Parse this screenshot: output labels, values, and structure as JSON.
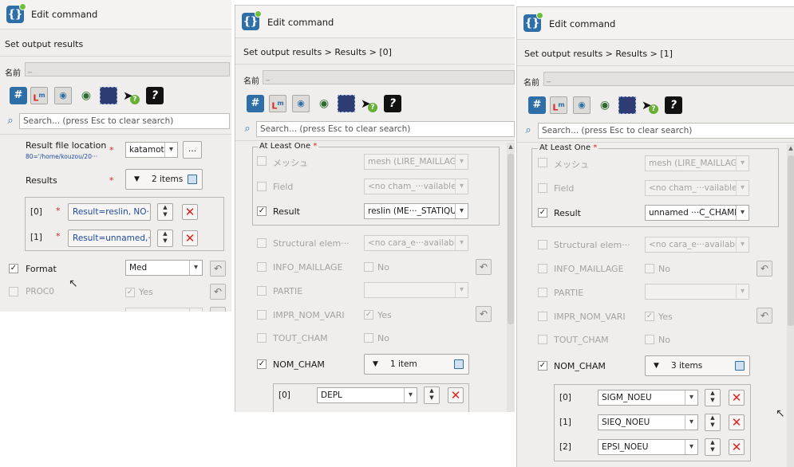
{
  "window_title": "Edit command",
  "panel1": {
    "breadcrumb": "Set output results",
    "name_label": "名前",
    "name_value": "_",
    "search_placeholder": "Search... (press Esc to clear search)",
    "result_file_location": {
      "label": "Result file location",
      "path": "80='/home/kouzou/20···",
      "value": "katamoti",
      "browse": "..."
    },
    "results": {
      "label": "Results",
      "count": "2 items",
      "rows": [
        {
          "index": "[0]",
          "value": "Result=reslin, NO···"
        },
        {
          "index": "[1]",
          "value": "Result=unnamed,···"
        }
      ]
    },
    "format": {
      "label": "Format",
      "value": "Med",
      "checked": "✓"
    },
    "proc0": {
      "label": "PROC0",
      "value": "Yes",
      "checked": "✓"
    }
  },
  "panel2": {
    "breadcrumb": "Set output results > Results > [0]",
    "name_label": "名前",
    "name_value": "_",
    "search_placeholder": "Search... (press Esc to clear search)",
    "group_label": "At Least One",
    "mesh": {
      "label": "メッシュ",
      "value": "mesh (LIRE_MAILLAGE)"
    },
    "field": {
      "label": "Field",
      "value": "<no cham_···vailable>"
    },
    "result": {
      "label": "Result",
      "value": "reslin (ME···_STATIQUE",
      "checked": "✓"
    },
    "structural": {
      "label": "Structural elem···",
      "value": "<no cara_e···available>"
    },
    "info_maillage": {
      "label": "INFO_MAILLAGE",
      "value": "No"
    },
    "partie": {
      "label": "PARTIE"
    },
    "impr_nom_vari": {
      "label": "IMPR_NOM_VARI",
      "value": "Yes",
      "checked": "✓"
    },
    "tout_cham": {
      "label": "TOUT_CHAM",
      "value": "No"
    },
    "nom_cham": {
      "label": "NOM_CHAM",
      "count": "1 item",
      "checked": "✓",
      "rows": [
        {
          "index": "[0]",
          "value": "DEPL"
        }
      ]
    }
  },
  "panel3": {
    "breadcrumb": "Set output results > Results > [1]",
    "name_label": "名前",
    "name_value": "_",
    "search_placeholder": "Search... (press Esc to clear search)",
    "group_label": "At Least One",
    "mesh": {
      "label": "メッシュ",
      "value": "mesh (LIRE_MAILLAGE)"
    },
    "field": {
      "label": "Field",
      "value": "<no cham_···vailable>"
    },
    "result": {
      "label": "Result",
      "value": "unnamed ···C_CHAMP)",
      "checked": "✓"
    },
    "structural": {
      "label": "Structural elem···",
      "value": "<no cara_e···available>"
    },
    "info_maillage": {
      "label": "INFO_MAILLAGE",
      "value": "No"
    },
    "partie": {
      "label": "PARTIE"
    },
    "impr_nom_vari": {
      "label": "IMPR_NOM_VARI",
      "value": "Yes",
      "checked": "✓"
    },
    "tout_cham": {
      "label": "TOUT_CHAM",
      "value": "No"
    },
    "nom_cham": {
      "label": "NOM_CHAM",
      "count": "3 items",
      "checked": "✓",
      "rows": [
        {
          "index": "[0]",
          "value": "SIGM_NOEU"
        },
        {
          "index": "[1]",
          "value": "SIEQ_NOEU"
        },
        {
          "index": "[2]",
          "value": "EPSI_NOEU"
        }
      ]
    }
  },
  "common": {
    "required_mark": "*",
    "app_glyph": "{}",
    "toolbar_hash": "#",
    "toolbar_lm": "L",
    "toolbar_lm_sup": "m",
    "toolbar_help": "?"
  }
}
